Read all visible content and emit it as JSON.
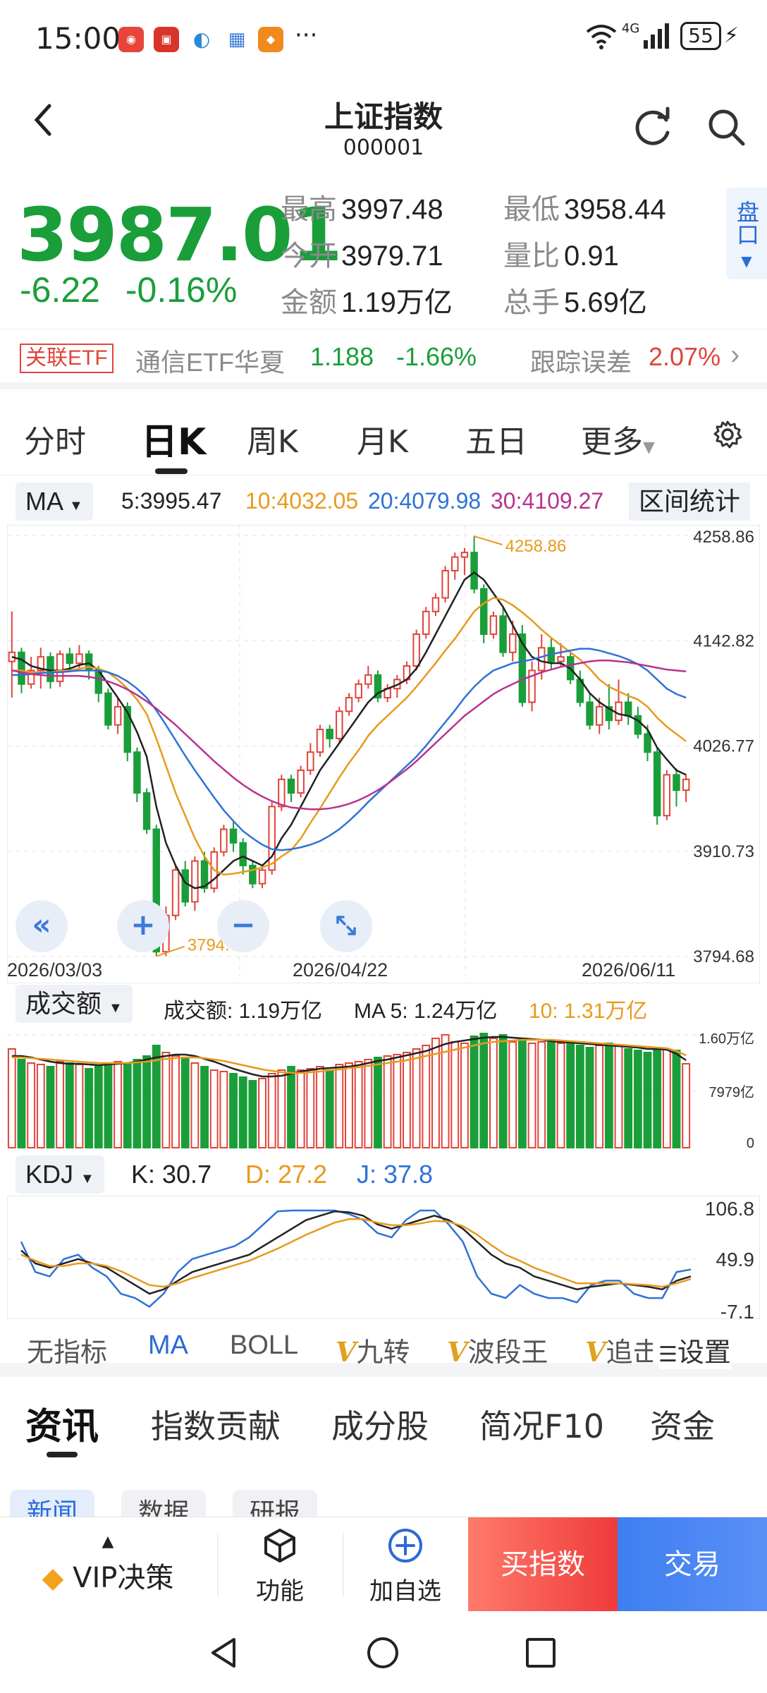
{
  "status_bar": {
    "time": "15:00",
    "network": "4G",
    "battery": "55",
    "dots": "···"
  },
  "header": {
    "title": "上证指数",
    "code": "000001"
  },
  "quote": {
    "price": "3987.01",
    "change": "-6.22",
    "change_pct": "-0.16%",
    "stats": [
      {
        "label": "最高",
        "value": "3997.48"
      },
      {
        "label": "最低",
        "value": "3958.44"
      },
      {
        "label": "今开",
        "value": "3979.71"
      },
      {
        "label": "量比",
        "value": "0.91"
      },
      {
        "label": "金额",
        "value": "1.19万亿"
      },
      {
        "label": "总手",
        "value": "5.69亿"
      }
    ],
    "pankou_label": "盘口"
  },
  "etf": {
    "tag": "关联ETF",
    "name": "通信ETF华夏",
    "price": "1.188",
    "change": "-1.66%",
    "track_label": "跟踪误差",
    "track_value": "2.07%"
  },
  "period_tabs": [
    "分时",
    "日K",
    "周K",
    "月K",
    "五日",
    "更多"
  ],
  "active_period": "日K",
  "ma": {
    "selector": "MA",
    "ma5": "5:3995.47",
    "ma10": "10:4032.05",
    "ma20": "20:4079.98",
    "ma30": "30:4109.27",
    "range_stats": "区间统计"
  },
  "colors": {
    "up": "#e0443b",
    "down": "#1a9e3a",
    "ma5": "#222222",
    "ma10": "#e89a1c",
    "ma20": "#2f72d6",
    "ma30": "#b8338e",
    "accent": "#2a6ad8"
  },
  "chart_data": [
    {
      "type": "candlestick",
      "title": "",
      "y_ticks": [
        "4258.86",
        "4142.82",
        "4026.77",
        "3910.73",
        "3794.68"
      ],
      "ylim": [
        3794.68,
        4258.86
      ],
      "x_labels": [
        "2026/03/03",
        "2026/04/22",
        "2026/06/11"
      ],
      "annotations": {
        "max": "4258.86",
        "min": "3794.68"
      },
      "candles": [
        [
          4120,
          4130,
          4080,
          4175
        ],
        [
          4130,
          4095,
          4085,
          4135
        ],
        [
          4095,
          4110,
          4090,
          4125
        ],
        [
          4110,
          4125,
          4090,
          4135
        ],
        [
          4125,
          4098,
          4090,
          4130
        ],
        [
          4098,
          4128,
          4092,
          4132
        ],
        [
          4128,
          4118,
          4110,
          4135
        ],
        [
          4118,
          4128,
          4112,
          4138
        ],
        [
          4128,
          4110,
          4100,
          4132
        ],
        [
          4110,
          4085,
          4075,
          4115
        ],
        [
          4085,
          4050,
          4045,
          4090
        ],
        [
          4050,
          4070,
          4040,
          4080
        ],
        [
          4070,
          4020,
          4010,
          4075
        ],
        [
          4020,
          3975,
          3965,
          4025
        ],
        [
          3975,
          3935,
          3930,
          3980
        ],
        [
          3935,
          3800,
          3795,
          3940
        ],
        [
          3800,
          3840,
          3795,
          3850
        ],
        [
          3840,
          3890,
          3835,
          3895
        ],
        [
          3890,
          3855,
          3850,
          3900
        ],
        [
          3855,
          3900,
          3845,
          3905
        ],
        [
          3900,
          3870,
          3865,
          3910
        ],
        [
          3870,
          3910,
          3865,
          3915
        ],
        [
          3910,
          3935,
          3905,
          3940
        ],
        [
          3935,
          3920,
          3910,
          3945
        ],
        [
          3920,
          3895,
          3885,
          3925
        ],
        [
          3895,
          3875,
          3870,
          3900
        ],
        [
          3875,
          3890,
          3870,
          3895
        ],
        [
          3890,
          3960,
          3885,
          3965
        ],
        [
          3960,
          3990,
          3955,
          3995
        ],
        [
          3990,
          3975,
          3965,
          3995
        ],
        [
          3975,
          4000,
          3970,
          4005
        ],
        [
          4000,
          4020,
          3995,
          4030
        ],
        [
          4020,
          4045,
          4015,
          4050
        ],
        [
          4045,
          4035,
          4025,
          4050
        ],
        [
          4035,
          4065,
          4030,
          4070
        ],
        [
          4065,
          4080,
          4060,
          4085
        ],
        [
          4080,
          4095,
          4075,
          4100
        ],
        [
          4095,
          4105,
          4090,
          4115
        ],
        [
          4105,
          4080,
          4075,
          4110
        ],
        [
          4080,
          4090,
          4075,
          4095
        ],
        [
          4090,
          4100,
          4080,
          4105
        ],
        [
          4100,
          4115,
          4095,
          4120
        ],
        [
          4115,
          4150,
          4110,
          4155
        ],
        [
          4150,
          4175,
          4145,
          4180
        ],
        [
          4175,
          4190,
          4170,
          4195
        ],
        [
          4190,
          4220,
          4185,
          4225
        ],
        [
          4220,
          4235,
          4210,
          4240
        ],
        [
          4235,
          4240,
          4215,
          4245
        ],
        [
          4240,
          4200,
          4195,
          4258
        ],
        [
          4200,
          4150,
          4140,
          4205
        ],
        [
          4150,
          4170,
          4145,
          4175
        ],
        [
          4170,
          4130,
          4125,
          4180
        ],
        [
          4130,
          4150,
          4120,
          4165
        ],
        [
          4150,
          4075,
          4070,
          4160
        ],
        [
          4075,
          4110,
          4065,
          4120
        ],
        [
          4110,
          4135,
          4100,
          4150
        ],
        [
          4135,
          4120,
          4110,
          4145
        ],
        [
          4120,
          4125,
          4115,
          4140
        ],
        [
          4125,
          4100,
          4095,
          4130
        ],
        [
          4100,
          4075,
          4070,
          4110
        ],
        [
          4075,
          4050,
          4045,
          4085
        ],
        [
          4050,
          4070,
          4040,
          4080
        ],
        [
          4070,
          4055,
          4045,
          4095
        ],
        [
          4055,
          4075,
          4050,
          4100
        ],
        [
          4075,
          4060,
          4050,
          4085
        ],
        [
          4060,
          4040,
          4035,
          4070
        ],
        [
          4040,
          4020,
          4010,
          4050
        ],
        [
          4020,
          3950,
          3940,
          4025
        ],
        [
          3950,
          3995,
          3945,
          4000
        ],
        [
          3995,
          3978,
          3960,
          4002
        ],
        [
          3978,
          3990,
          3965,
          3995
        ]
      ],
      "ma5": [
        4125,
        4122,
        4115,
        4112,
        4110,
        4110,
        4112,
        4116,
        4118,
        4110,
        4095,
        4080,
        4064,
        4042,
        4015,
        3960,
        3920,
        3895,
        3876,
        3870,
        3872,
        3880,
        3890,
        3900,
        3905,
        3900,
        3895,
        3905,
        3925,
        3940,
        3960,
        3980,
        4000,
        4015,
        4030,
        4045,
        4060,
        4075,
        4085,
        4090,
        4094,
        4100,
        4112,
        4130,
        4150,
        4170,
        4190,
        4210,
        4218,
        4210,
        4195,
        4180,
        4160,
        4140,
        4125,
        4120,
        4118,
        4118,
        4112,
        4100,
        4085,
        4075,
        4068,
        4062,
        4060,
        4055,
        4045,
        4025,
        4012,
        4000,
        3995
      ],
      "ma10": [
        4110,
        4110,
        4108,
        4108,
        4108,
        4110,
        4110,
        4112,
        4114,
        4112,
        4108,
        4100,
        4090,
        4078,
        4062,
        4035,
        4005,
        3975,
        3950,
        3925,
        3905,
        3890,
        3885,
        3886,
        3888,
        3890,
        3893,
        3897,
        3905,
        3912,
        3925,
        3942,
        3958,
        3975,
        3992,
        4008,
        4022,
        4038,
        4050,
        4060,
        4070,
        4080,
        4092,
        4105,
        4118,
        4132,
        4145,
        4160,
        4175,
        4184,
        4190,
        4188,
        4182,
        4174,
        4165,
        4155,
        4146,
        4138,
        4130,
        4122,
        4112,
        4100,
        4092,
        4087,
        4082,
        4078,
        4070,
        4058,
        4048,
        4040,
        4032
      ],
      "ma20": [
        4105,
        4105,
        4106,
        4107,
        4108,
        4108,
        4109,
        4110,
        4110,
        4110,
        4108,
        4104,
        4098,
        4090,
        4080,
        4066,
        4050,
        4033,
        4016,
        4000,
        3985,
        3970,
        3956,
        3944,
        3933,
        3925,
        3918,
        3913,
        3912,
        3913,
        3915,
        3918,
        3922,
        3928,
        3935,
        3944,
        3954,
        3965,
        3975,
        3985,
        3995,
        4005,
        4015,
        4027,
        4040,
        4053,
        4066,
        4080,
        4092,
        4102,
        4110,
        4114,
        4118,
        4120,
        4122,
        4125,
        4128,
        4130,
        4132,
        4134,
        4134,
        4132,
        4129,
        4126,
        4122,
        4117,
        4110,
        4100,
        4090,
        4084,
        4080
      ],
      "ma30": [
        4110,
        4108,
        4106,
        4105,
        4104,
        4104,
        4104,
        4104,
        4103,
        4101,
        4098,
        4094,
        4089,
        4083,
        4076,
        4068,
        4059,
        4050,
        4040,
        4030,
        4020,
        4010,
        4001,
        3992,
        3984,
        3977,
        3971,
        3966,
        3962,
        3959,
        3958,
        3957,
        3957,
        3958,
        3960,
        3963,
        3967,
        3972,
        3978,
        3985,
        3993,
        4001,
        4010,
        4020,
        4030,
        4040,
        4050,
        4060,
        4068,
        4076,
        4084,
        4090,
        4095,
        4100,
        4104,
        4108,
        4111,
        4114,
        4116,
        4118,
        4120,
        4121,
        4121,
        4120,
        4119,
        4117,
        4115,
        4113,
        4111,
        4110,
        4109
      ]
    },
    {
      "type": "bar",
      "title": "成交额",
      "y_ticks": [
        "1.60万亿",
        "7979亿",
        "0"
      ],
      "ylim": [
        0,
        1.6
      ],
      "values": [
        1.4,
        1.25,
        1.2,
        1.18,
        1.15,
        1.22,
        1.2,
        1.18,
        1.12,
        1.15,
        1.2,
        1.22,
        1.2,
        1.25,
        1.3,
        1.45,
        1.35,
        1.3,
        1.28,
        1.2,
        1.15,
        1.1,
        1.08,
        1.05,
        1.0,
        0.95,
        0.98,
        1.05,
        1.1,
        1.15,
        1.1,
        1.12,
        1.15,
        1.1,
        1.18,
        1.2,
        1.22,
        1.25,
        1.28,
        1.3,
        1.32,
        1.35,
        1.4,
        1.45,
        1.55,
        1.6,
        1.5,
        1.48,
        1.58,
        1.62,
        1.55,
        1.6,
        1.5,
        1.55,
        1.48,
        1.5,
        1.52,
        1.48,
        1.5,
        1.45,
        1.42,
        1.45,
        1.48,
        1.44,
        1.4,
        1.38,
        1.35,
        1.42,
        1.4,
        1.38,
        1.19
      ],
      "ma5": [
        1.3,
        1.3,
        1.28,
        1.25,
        1.22,
        1.2,
        1.19,
        1.19,
        1.18,
        1.17,
        1.18,
        1.19,
        1.2,
        1.22,
        1.25,
        1.28,
        1.3,
        1.32,
        1.32,
        1.3,
        1.26,
        1.22,
        1.17,
        1.12,
        1.08,
        1.04,
        1.01,
        1.01,
        1.02,
        1.05,
        1.08,
        1.1,
        1.12,
        1.13,
        1.14,
        1.15,
        1.17,
        1.2,
        1.23,
        1.25,
        1.28,
        1.31,
        1.34,
        1.37,
        1.42,
        1.47,
        1.5,
        1.52,
        1.54,
        1.56,
        1.57,
        1.57,
        1.56,
        1.55,
        1.54,
        1.53,
        1.51,
        1.5,
        1.49,
        1.48,
        1.47,
        1.46,
        1.45,
        1.44,
        1.43,
        1.42,
        1.4,
        1.4,
        1.39,
        1.33,
        1.24
      ],
      "ma10": [
        1.28,
        1.28,
        1.27,
        1.26,
        1.25,
        1.24,
        1.23,
        1.22,
        1.21,
        1.2,
        1.2,
        1.2,
        1.2,
        1.21,
        1.22,
        1.24,
        1.26,
        1.27,
        1.28,
        1.28,
        1.27,
        1.25,
        1.23,
        1.2,
        1.17,
        1.14,
        1.11,
        1.09,
        1.07,
        1.06,
        1.06,
        1.07,
        1.08,
        1.1,
        1.11,
        1.13,
        1.14,
        1.16,
        1.18,
        1.2,
        1.22,
        1.24,
        1.27,
        1.3,
        1.33,
        1.36,
        1.39,
        1.42,
        1.45,
        1.48,
        1.5,
        1.51,
        1.52,
        1.53,
        1.53,
        1.53,
        1.53,
        1.52,
        1.51,
        1.5,
        1.49,
        1.48,
        1.47,
        1.46,
        1.45,
        1.44,
        1.43,
        1.42,
        1.41,
        1.37,
        1.31
      ]
    },
    {
      "type": "line",
      "title": "KDJ",
      "y_ticks": [
        "106.8",
        "49.9",
        "-7.1"
      ],
      "ylim": [
        -7.1,
        106.8
      ],
      "K": [
        60,
        45,
        40,
        45,
        50,
        45,
        40,
        30,
        20,
        10,
        15,
        25,
        35,
        40,
        45,
        50,
        55,
        65,
        75,
        85,
        95,
        100,
        105,
        104,
        100,
        90,
        85,
        90,
        95,
        100,
        95,
        85,
        70,
        55,
        45,
        40,
        30,
        25,
        20,
        15,
        18,
        20,
        22,
        20,
        18,
        15,
        25,
        30
      ],
      "D": [
        55,
        48,
        42,
        42,
        45,
        45,
        42,
        36,
        28,
        20,
        18,
        22,
        28,
        33,
        38,
        43,
        48,
        55,
        62,
        70,
        78,
        85,
        92,
        96,
        96,
        92,
        89,
        89,
        91,
        94,
        93,
        88,
        78,
        66,
        55,
        48,
        40,
        34,
        28,
        22,
        22,
        22,
        22,
        21,
        20,
        18,
        22,
        27
      ],
      "J": [
        70,
        35,
        30,
        50,
        55,
        40,
        30,
        10,
        5,
        -5,
        10,
        35,
        50,
        55,
        60,
        65,
        75,
        90,
        105,
        106,
        106,
        106,
        106,
        102,
        95,
        80,
        75,
        95,
        106,
        106,
        90,
        70,
        30,
        10,
        5,
        20,
        10,
        5,
        5,
        0,
        20,
        25,
        25,
        10,
        5,
        5,
        35,
        38
      ]
    }
  ],
  "volume_header": {
    "selector": "成交额",
    "amount": "成交额: 1.19万亿",
    "ma5": "MA 5: 1.24万亿",
    "ma10": "10: 1.31万亿"
  },
  "kdj_header": {
    "selector": "KDJ",
    "k": "K: 30.7",
    "d": "D: 27.2",
    "j": "J: 37.8"
  },
  "indicator_tabs": [
    "无指标",
    "MA",
    "BOLL",
    "九转",
    "波段王",
    "追击",
    "设置"
  ],
  "info_tabs": [
    "资讯",
    "指数贡献",
    "成分股",
    "简况F10",
    "资金"
  ],
  "info_sub_tabs": [
    "新闻",
    "数据",
    "研报"
  ],
  "bottom_bar": {
    "vip": "VIP决策",
    "function": "功能",
    "add_watch": "加自选",
    "buy": "买指数",
    "trade": "交易"
  }
}
